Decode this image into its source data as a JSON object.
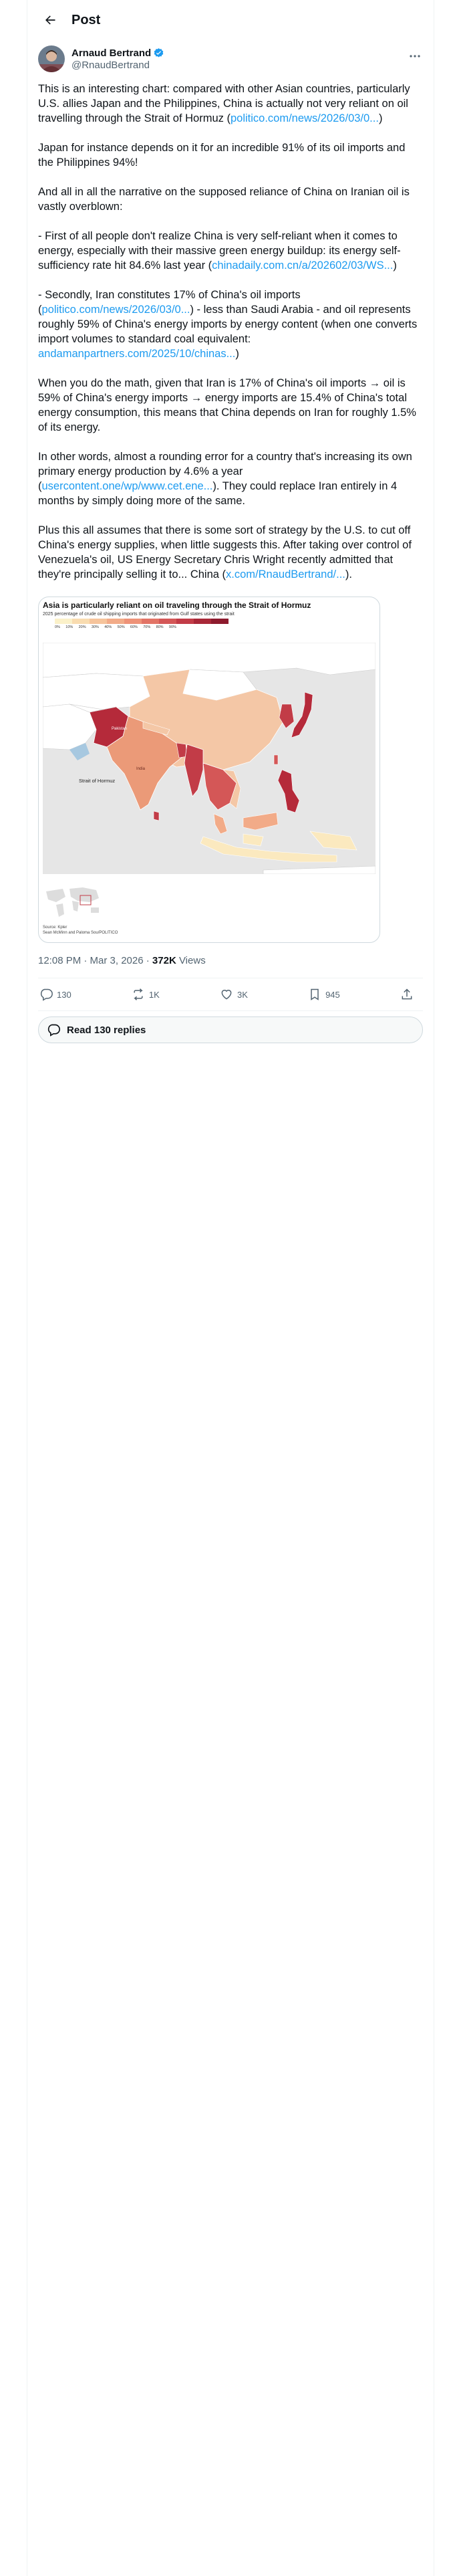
{
  "header": {
    "title": "Post"
  },
  "author": {
    "name": "Arnaud Bertrand",
    "handle": "@RnaudBertrand"
  },
  "tweet": {
    "paragraphs": [
      {
        "parts": [
          {
            "text": "This is an interesting chart: compared with other Asian countries, particularly U.S. allies Japan and the Philippines, China is actually not very reliant on oil travelling through the Strait of Hormuz (",
            "link": false
          },
          {
            "text": "politico.com/news/2026/03/0...",
            "link": true
          },
          {
            "text": ")",
            "link": false
          }
        ]
      },
      {
        "parts": [
          {
            "text": "Japan for instance depends on it for an incredible 91% of its oil imports and the Philippines 94%!",
            "link": false
          }
        ]
      },
      {
        "parts": [
          {
            "text": "And all in all the narrative on the supposed reliance of China on Iranian oil is vastly overblown:",
            "link": false
          }
        ]
      },
      {
        "parts": [
          {
            "text": "- First of all people don't realize China is very self-reliant when it comes to energy, especially with their massive green energy buildup: its energy self-sufficiency rate hit 84.6% last year (",
            "link": false
          },
          {
            "text": "chinadaily.com.cn/a/202602/03/WS...",
            "link": true
          },
          {
            "text": ")",
            "link": false
          }
        ]
      },
      {
        "parts": [
          {
            "text": "- Secondly, Iran constitutes 17% of China's oil imports (",
            "link": false
          },
          {
            "text": "politico.com/news/2026/03/0...",
            "link": true
          },
          {
            "text": ") - less than Saudi Arabia - and oil represents roughly 59% of China's energy imports by energy content (when one converts import volumes to standard coal equivalent: ",
            "link": false
          },
          {
            "text": "andamanpartners.com/2025/10/chinas...",
            "link": true
          },
          {
            "text": ")",
            "link": false
          }
        ]
      },
      {
        "parts": [
          {
            "text": "When you do the math, given that Iran is 17% of China's oil imports → oil is 59% of China's energy imports → energy imports are 15.4% of China's total energy consumption, this means that China depends on Iran for roughly 1.5% of its energy.",
            "link": false
          }
        ]
      },
      {
        "parts": [
          {
            "text": "In other words, almost a rounding error for a country that's increasing its own primary energy production by 4.6% a year (",
            "link": false
          },
          {
            "text": "usercontent.one/wp/www.cet.ene...",
            "link": true
          },
          {
            "text": "). They could replace Iran entirely in 4 months by simply doing more of the same.",
            "link": false
          }
        ]
      },
      {
        "parts": [
          {
            "text": "Plus this all assumes that there is some sort of strategy by the U.S. to cut off China's energy supplies, when little suggests this. After taking over control of Venezuela's oil, US Energy Secretary Chris Wright recently admitted that they're principally selling it to... China (",
            "link": false
          },
          {
            "text": "x.com/RnaudBertrand/...",
            "link": true
          },
          {
            "text": ").",
            "link": false
          }
        ]
      }
    ]
  },
  "media": {
    "title": "Asia is particularly reliant on oil traveling through the Strait of Hormuz",
    "subtitle": "2025 percentage of crude oil shipping imports that originated from Gulf states using the strait",
    "legend_labels": [
      "0%",
      "10%",
      "20%",
      "30%",
      "40%",
      "50%",
      "60%",
      "70%",
      "80%",
      "90%"
    ],
    "legend_colors": [
      "#fbf1c9",
      "#f9dcb0",
      "#f6c49b",
      "#f2ab88",
      "#ee9278",
      "#e27466",
      "#d45757",
      "#c23c47",
      "#a82838",
      "#8d1a2d"
    ],
    "strait_label": "Strait of Hormuz",
    "source_line1": "Source: Kpler",
    "source_line2": "Sean McMinn and Paloma Sou/POLITICO"
  },
  "meta": {
    "time": "12:08 PM · Mar 3, 2026 · ",
    "views_count": "372K",
    "views_label": " Views"
  },
  "actions": {
    "replies": "130",
    "reposts": "1K",
    "likes": "3K",
    "bookmarks": "945"
  },
  "read_replies": "Read 130 replies"
}
